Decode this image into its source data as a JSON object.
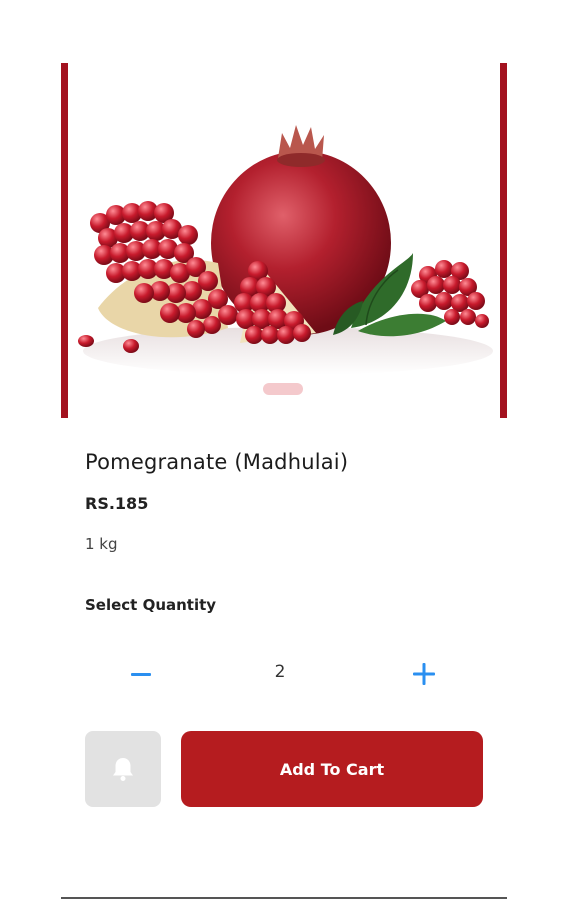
{
  "product": {
    "name": "Pomegranate (Madhulai)",
    "price": "RS.185",
    "unit": "1 kg",
    "image_icon": "pomegranate-photo"
  },
  "quantity": {
    "heading": "Select Quantity",
    "value": "2",
    "minus_icon": "minus-icon",
    "plus_icon": "plus-icon"
  },
  "actions": {
    "notify_icon": "bell-icon",
    "add_to_cart_label": "Add To Cart"
  },
  "colors": {
    "brand_red": "#b51c1f",
    "carousel_border": "#a3121f",
    "stepper_blue": "#2a8ff0",
    "notify_bg": "#e2e2e2"
  }
}
